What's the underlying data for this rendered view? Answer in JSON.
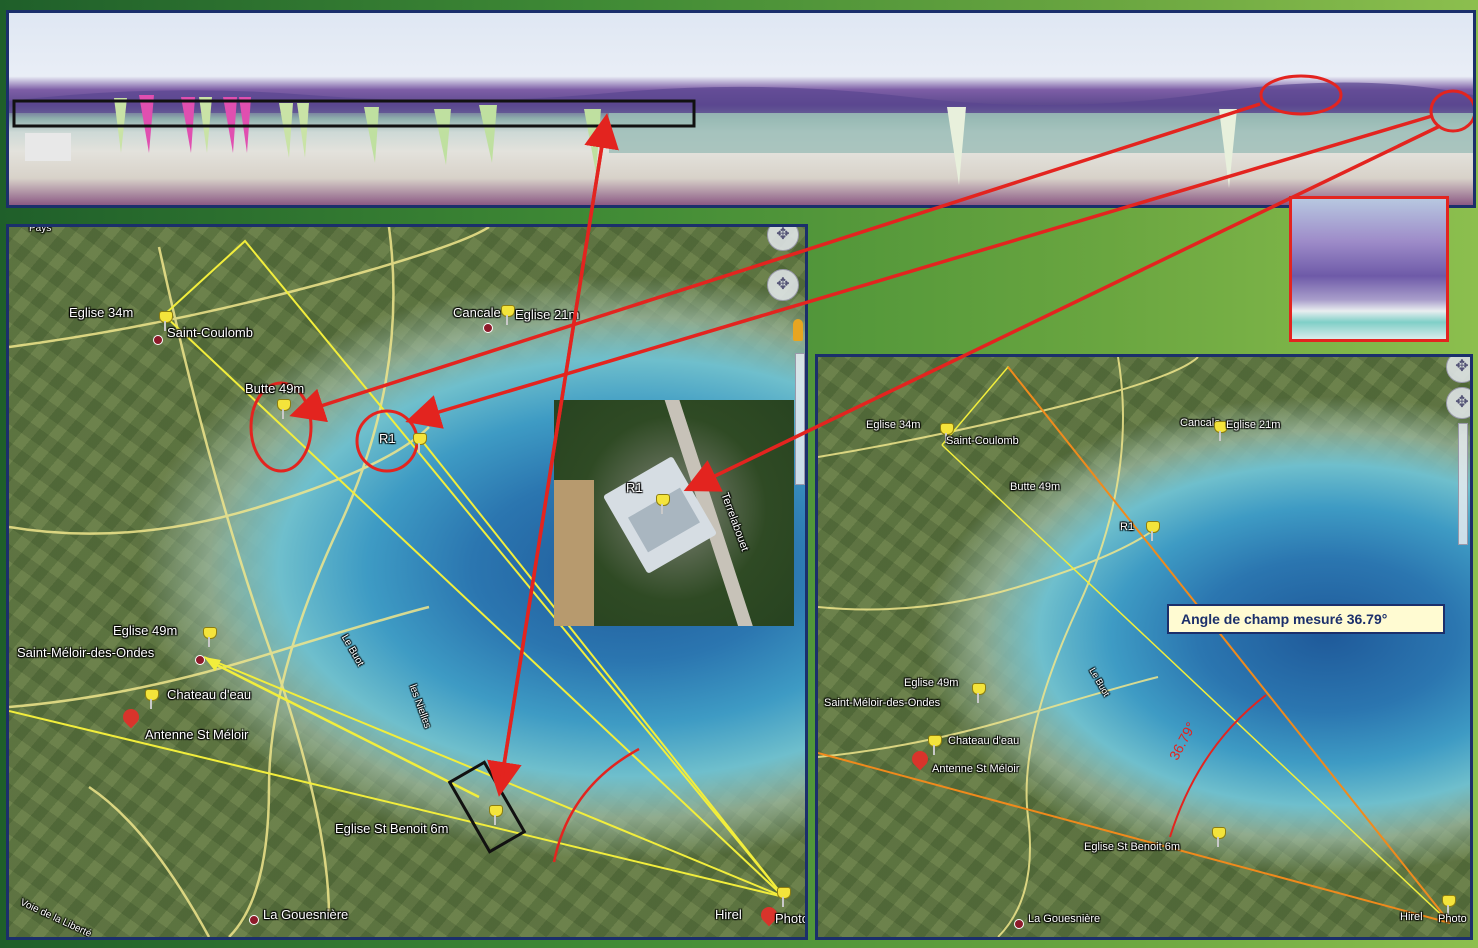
{
  "panorama": {
    "scene": "beach-panorama"
  },
  "left_map": {
    "labels": {
      "eglise34": "Eglise 34m",
      "saint_coulomb": "Saint-Coulomb",
      "cancale": "Cancale",
      "eglise21": "Eglise 21m",
      "butte": "Butte  49m",
      "r1": "R1",
      "eglise49": "Eglise 49m",
      "saint_meloir": "Saint-Méloir-des-Ondes",
      "chateau": "Chateau d'eau",
      "antenne": "Antenne St Méloir",
      "le_buot": "Le Buot",
      "les_nielles": "les Nielles",
      "eglise_st_benoit": "Eglise St Benoit  6m",
      "la_gouesniere": "La Gouesnière",
      "hirel": "Hirel",
      "photo": "Photo",
      "voie": "Voie de la Liberté",
      "pays": "Pays"
    }
  },
  "inset": {
    "r1": "R1",
    "road": "Terrelabouet"
  },
  "right_map": {
    "labels": {
      "eglise34": "Eglise 34m",
      "saint_coulomb": "Saint-Coulomb",
      "cancale": "Cancale",
      "eglise21": "Eglise 21m",
      "butte": "Butte  49m",
      "r1": "R1",
      "eglise49": "Eglise 49m",
      "saint_meloir": "Saint-Méloir-des-Ondes",
      "chateau": "Chateau d'eau",
      "antenne": "Antenne St Méloir",
      "le_buot": "Le Buot",
      "eglise_st_benoit": "Eglise St Benoit  6m",
      "la_gouesniere": "La Gouesnière",
      "hirel": "Hirel",
      "photo": "Photo"
    },
    "angle_text": "Angle de champ mesuré  36.79°",
    "angle_arc_label": "36.79°"
  },
  "colors": {
    "annotation_red": "#e3241f",
    "sight_line_yellow": "#f2ee3c",
    "sight_line_orange": "#f08a1c",
    "frame_blue": "#1b2f6b"
  }
}
